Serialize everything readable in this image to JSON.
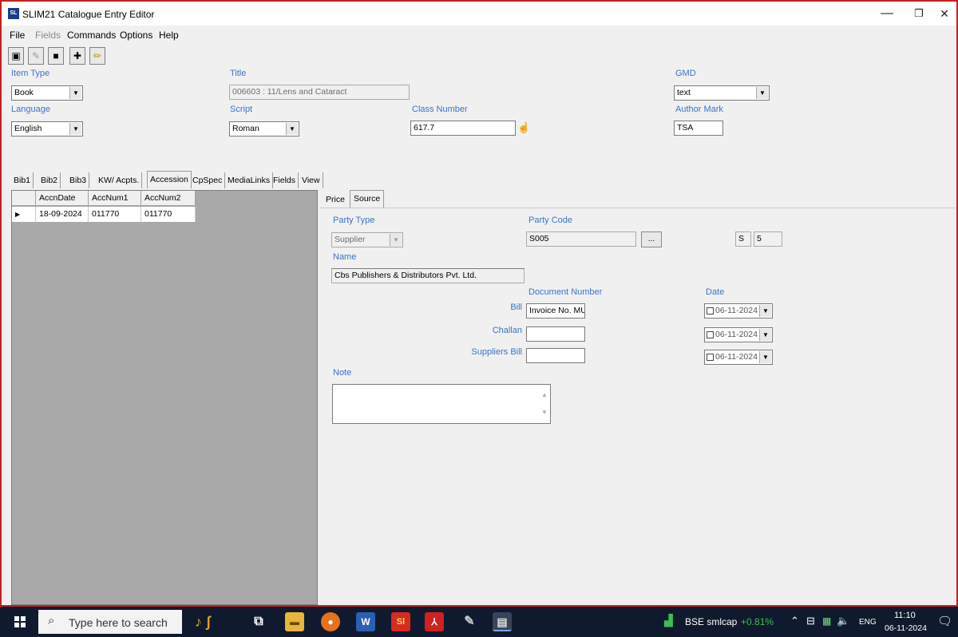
{
  "window": {
    "title": "SLIM21 Catalogue Entry Editor",
    "icon_text": "SL",
    "controls": {
      "minimize": "—",
      "restore": "❐",
      "close": "✕"
    }
  },
  "menu": [
    "File",
    "Fields",
    "Commands",
    "Options",
    "Help"
  ],
  "toolbar": [
    {
      "name": "new-record-icon",
      "glyph": "▣"
    },
    {
      "name": "edit-record-icon",
      "glyph": "✎"
    },
    {
      "name": "save-icon",
      "glyph": "■"
    },
    {
      "name": "add-icon",
      "glyph": "✚"
    },
    {
      "name": "pencil-icon",
      "glyph": "✏"
    }
  ],
  "header": {
    "item_type": {
      "label": "Item Type",
      "value": "Book"
    },
    "title": {
      "label": "Title",
      "value": "006603 : 11/Lens and Cataract"
    },
    "gmd": {
      "label": "GMD",
      "value": "text"
    },
    "language": {
      "label": "Language",
      "value": "English"
    },
    "script": {
      "label": "Script",
      "value": "Roman"
    },
    "class_number": {
      "label": "Class Number",
      "value": "617.7"
    },
    "author_mark": {
      "label": "Author Mark",
      "value": "TSA"
    }
  },
  "tabs": [
    "Bib1",
    "Bib2",
    "Bib3",
    "KW/ Acpts.",
    "Accession",
    "CpSpec",
    "MediaLinks",
    "Fields",
    "View"
  ],
  "active_tab": "Accession",
  "accession_grid": {
    "columns": [
      "AccnDate",
      "AccNum1",
      "AccNum2"
    ],
    "rows": [
      [
        "18-09-2024",
        "011770",
        "011770"
      ]
    ]
  },
  "subtabs": [
    "Price",
    "Source"
  ],
  "active_subtab": "Source",
  "source": {
    "party_type": {
      "label": "Party Type",
      "value": "Supplier"
    },
    "party_code": {
      "label": "Party Code",
      "value": "S005",
      "button": "..."
    },
    "code_prefix": "S",
    "code_number": "5",
    "name": {
      "label": "Name",
      "value": "Cbs Publishers & Distributors Pvt. Ltd."
    },
    "document_number_label": "Document Number",
    "date_label": "Date",
    "bill": {
      "label": "Bill",
      "doc": "Invoice No. MU/",
      "date": "06-11-2024"
    },
    "challan": {
      "label": "Challan",
      "doc": "",
      "date": "06-11-2024"
    },
    "suppliers_bill": {
      "label": "Suppliers Bill",
      "doc": "",
      "date": "06-11-2024"
    },
    "note": {
      "label": "Note",
      "value": ""
    }
  },
  "taskbar": {
    "search_placeholder": "Type here to search",
    "market_label": "BSE smlcap",
    "market_change": "+0.81%",
    "lang": "ENG",
    "time": "11:10",
    "date": "06-11-2024"
  },
  "colors": {
    "accent_label": "#3b73c8",
    "window_border": "#c81e1e",
    "taskbar": "#101a2e",
    "market_up": "#3fbf4f"
  }
}
